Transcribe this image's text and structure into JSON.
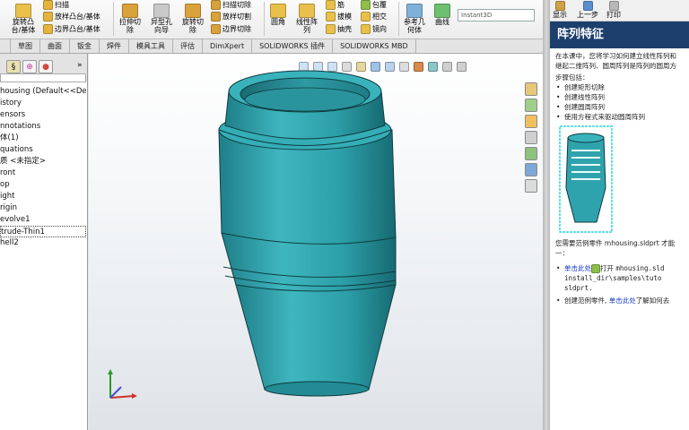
{
  "ribbon": {
    "features": {
      "boss_label": "旋转凸\n台/基体",
      "sweep_label": "扫描",
      "loft_label": "放样凸台/基体",
      "boundary_label": "边界凸台/基体",
      "extruded_cut_label": "拉伸切\n除",
      "hole_wizard_label": "异型孔\n向导",
      "revolved_cut_label": "旋转切\n除",
      "swept_cut_label": "扫描切除",
      "lofted_cut_label": "放样切割",
      "boundary_cut_label": "边界切除",
      "fillet_label": "圆角",
      "linear_pattern_label": "线性阵\n列",
      "rib_label": "筋",
      "draft_label": "拔模",
      "shell_label": "抽壳",
      "wrap_label": "包覆",
      "intersect_label": "相交",
      "mirror_label": "镜向",
      "reference_geometry_label": "参考几\n何体",
      "curves_label": "曲线",
      "instant3d_label": "Instant3D"
    }
  },
  "command_tabs": [
    "",
    "草图",
    "曲面",
    "钣金",
    "焊件",
    "模具工具",
    "评估",
    "DimXpert",
    "SOLIDWORKS 插件",
    "SOLIDWORKS MBD"
  ],
  "feature_tree": {
    "expand_label": "»",
    "items": [
      "housing  (Default<<Default",
      "istory",
      "ensors",
      "nnotations",
      "体(1)",
      "quations",
      "质 <未指定>",
      "ront",
      "op",
      "ight",
      "rigin",
      "evolve1",
      "trude-Thin1",
      "hell2"
    ]
  },
  "task_pane": {
    "toolbar": {
      "home": "显示",
      "back": "上一步",
      "print": "打印"
    },
    "title": "阵列特征",
    "intro_line1": "在本课中，您将学习如何建立线性阵列和",
    "intro_line2": "继起二维阵列、圆周阵列是阵列的圆周方",
    "steps_heading": "步骤包括：",
    "steps": [
      "创建矩形切除",
      "创建线性阵列",
      "创建圆周阵列",
      "使用方程式来驱动圆周阵列"
    ],
    "need_part_line1": "您需要范例零件 mhousing.sldprt 才能",
    "need_part_line2": "一：",
    "click_here": "单击此处",
    "open_text": "打开",
    "path_line1": "mhousing.sld",
    "path_line2": "install_dir\\samples\\tuto",
    "path_line3": "sldprt.",
    "create_part_text": "创建范例零件,",
    "click_here2": "单击此处",
    "learn_text": "了解如何去"
  },
  "colors": {
    "model": "#2fa3ad",
    "model_dark": "#1d7780",
    "task_title_bg": "#1d3f6d",
    "link": "#1a3fc4"
  }
}
